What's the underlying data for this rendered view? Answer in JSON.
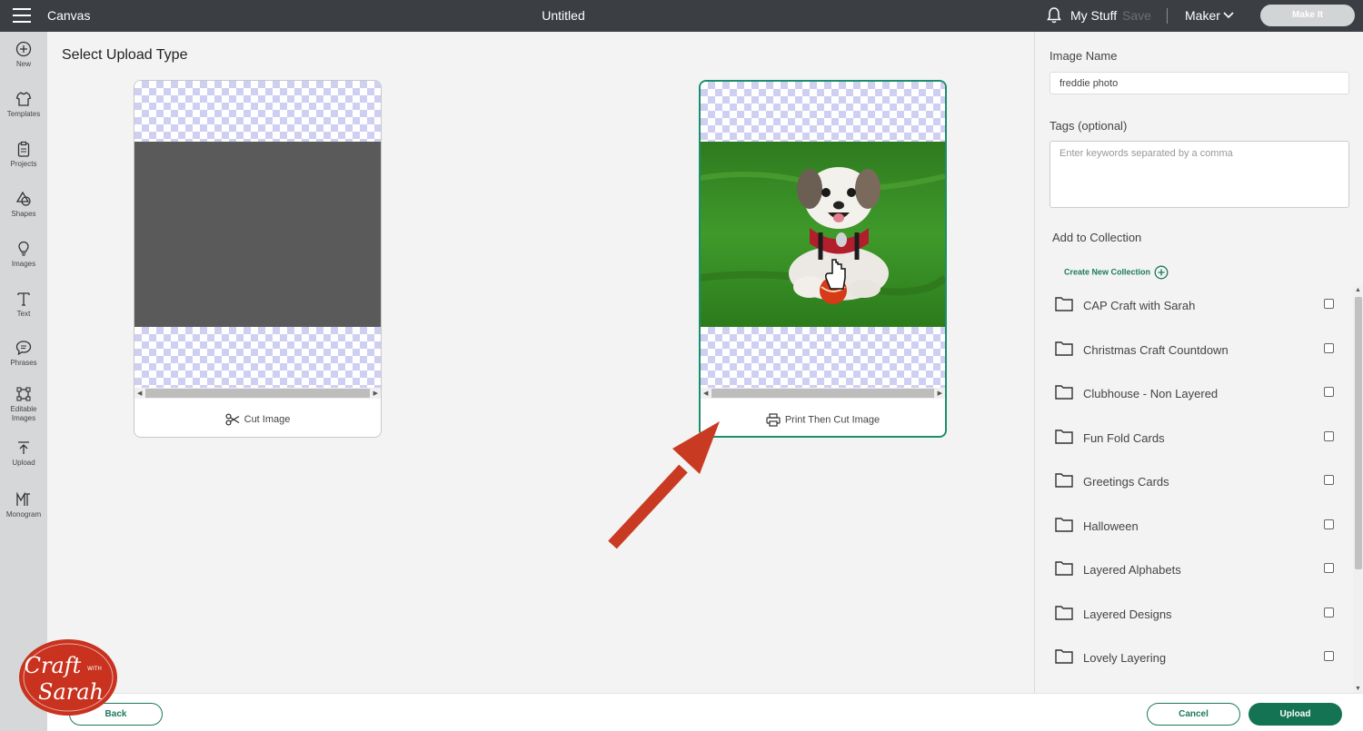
{
  "topbar": {
    "app_name": "Canvas",
    "doc_title": "Untitled",
    "my_stuff": "My Stuff",
    "save": "Save",
    "machine": "Maker",
    "make_it": "Make It"
  },
  "rail": [
    {
      "label": "New",
      "icon": "plus-circle-icon"
    },
    {
      "label": "Templates",
      "icon": "shirt-icon"
    },
    {
      "label": "Projects",
      "icon": "clipboard-icon"
    },
    {
      "label": "Shapes",
      "icon": "shapes-icon"
    },
    {
      "label": "Images",
      "icon": "lightbulb-icon"
    },
    {
      "label": "Text",
      "icon": "text-icon"
    },
    {
      "label": "Phrases",
      "icon": "speech-bubble-icon"
    },
    {
      "label": "Editable Images",
      "icon": "editable-image-icon"
    },
    {
      "label": "Upload",
      "icon": "upload-icon"
    },
    {
      "label": "Monogram",
      "icon": "monogram-icon"
    }
  ],
  "main": {
    "heading": "Select Upload Type",
    "cut_card": {
      "label": "Cut Image",
      "icon": "scissors-icon"
    },
    "print_card": {
      "label": "Print Then Cut Image",
      "icon": "printer-icon"
    }
  },
  "panel": {
    "image_name_label": "Image Name",
    "image_name_value": "freddie photo",
    "tags_label": "Tags (optional)",
    "tags_placeholder": "Enter keywords separated by a comma",
    "collection_label": "Add to Collection",
    "create_collection": "Create New Collection",
    "collections": [
      "CAP Craft with Sarah",
      "Christmas Craft Countdown",
      "Clubhouse - Non Layered",
      "Fun Fold Cards",
      "Greetings Cards",
      "Halloween",
      "Layered Alphabets",
      "Layered Designs",
      "Lovely Layering"
    ]
  },
  "footer": {
    "back": "Back",
    "cancel": "Cancel",
    "upload": "Upload"
  },
  "watermark": {
    "line1": "Craft",
    "line2": "WITH",
    "line3": "Sarah"
  },
  "colors": {
    "accent": "#1b8f6b",
    "topbar": "#3b3f44",
    "arrow": "#c93a22",
    "watermark": "#c8321e"
  }
}
